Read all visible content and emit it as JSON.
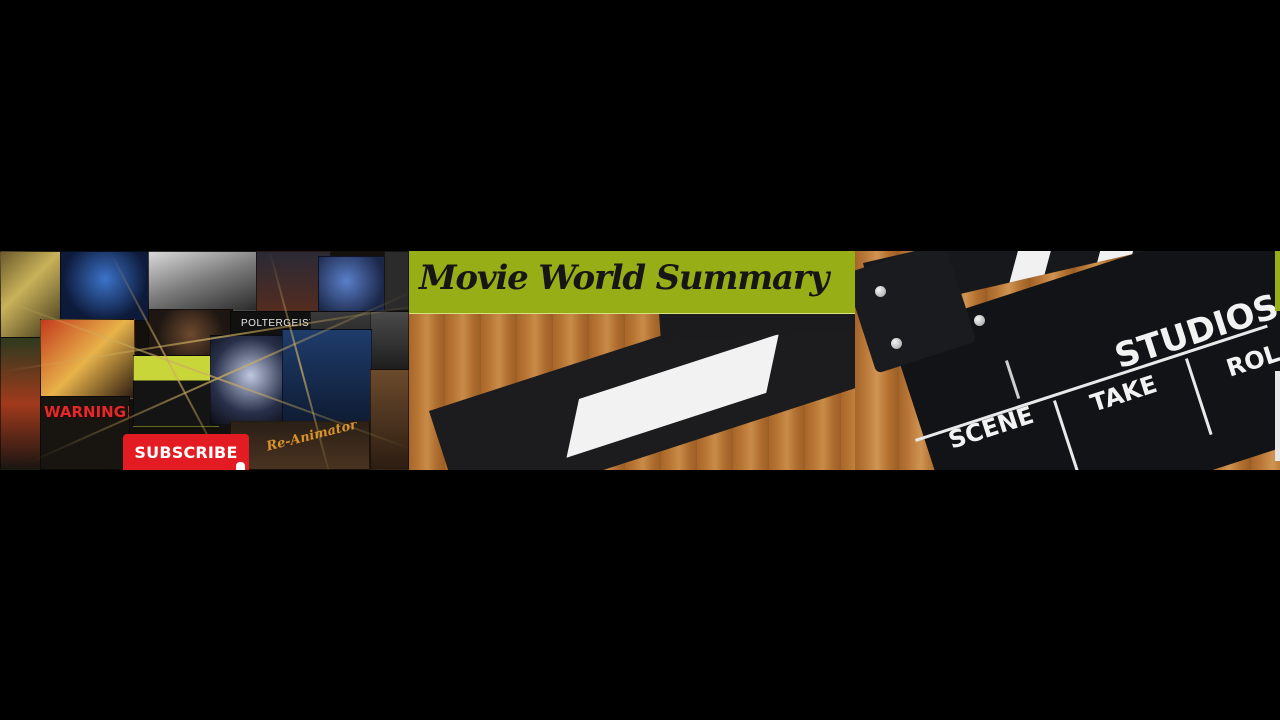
{
  "banner": {
    "collage": {
      "poster_texts": {
        "poltergeist": "POLTERGEIST II",
        "warning": "WARNING!",
        "reanimator": "Re-Animator"
      },
      "subscribe_label": "SUBSCRIBE",
      "subscribe_color": "#e31b22"
    },
    "title": "Movie World Summary",
    "title_bar_color": "#97ae16",
    "clapperboard": {
      "studio": "STUDIOS",
      "scene": "SCENE",
      "take": "TAKE",
      "roll": "ROL"
    }
  }
}
